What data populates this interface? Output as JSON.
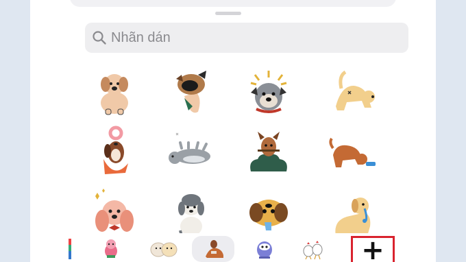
{
  "search": {
    "placeholder": "Nhãn dán",
    "icon": "search-icon"
  },
  "stickers": [
    {
      "name": "sitting-beige-dog"
    },
    {
      "name": "dog-with-sunglasses"
    },
    {
      "name": "grumpy-bulldog"
    },
    {
      "name": "stretching-dog"
    },
    {
      "name": "dog-with-donut"
    },
    {
      "name": "rolling-gray-dog"
    },
    {
      "name": "dog-in-bush"
    },
    {
      "name": "dog-drinking-water"
    },
    {
      "name": "happy-pink-dog"
    },
    {
      "name": "gray-puppy"
    },
    {
      "name": "goofy-dog"
    },
    {
      "name": "crying-dog"
    }
  ],
  "tray": {
    "packs": [
      "pink-character-pack",
      "bear-pack",
      "dog-pack",
      "purple-creature-pack",
      "chicken-pack"
    ],
    "selected": "dog-pack",
    "add_label": "+"
  },
  "colors": {
    "highlight": "#d9232e",
    "search_bg": "#eeeef0"
  }
}
